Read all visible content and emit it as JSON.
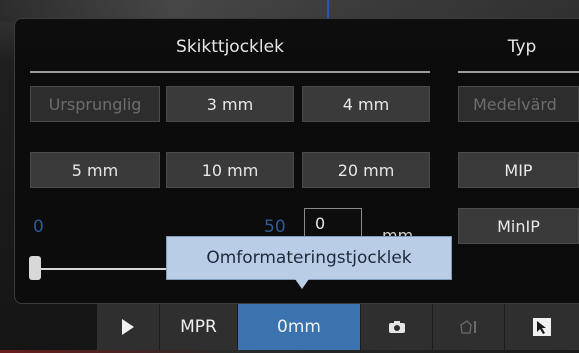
{
  "section_thickness": {
    "title": "Skikttjocklek",
    "buttons": [
      "Ursprunglig",
      "3 mm",
      "4 mm",
      "5 mm",
      "10 mm",
      "20 mm"
    ]
  },
  "section_type": {
    "title": "Typ",
    "buttons": [
      "Medelvärd",
      "MIP",
      "MinIP"
    ]
  },
  "range": {
    "min_label": "0",
    "max_label": "50",
    "value": "0",
    "unit": "mm",
    "slider_fraction": 0
  },
  "tooltip": {
    "text": "Omformateringstjocklek"
  },
  "toolbar": {
    "play_icon": "play-icon",
    "mpr_label": "MPR",
    "thickness_label": "0mm",
    "camera_icon": "camera-icon",
    "shape_icon": "polygon-icon",
    "cursor_icon": "cursor-icon",
    "active_color": "#3a73ad"
  }
}
